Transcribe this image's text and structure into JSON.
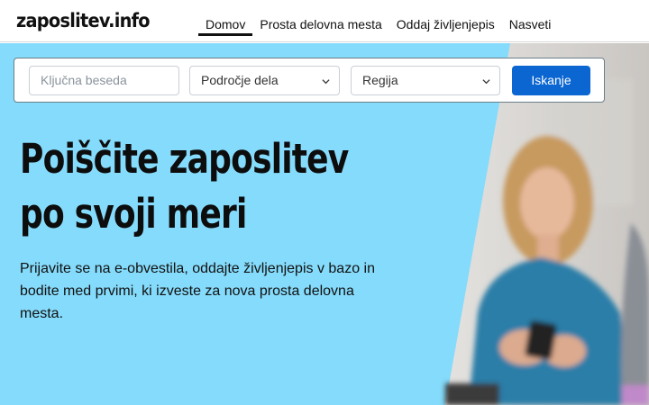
{
  "header": {
    "logo": "zaposlitev.info",
    "nav": [
      {
        "label": "Domov",
        "active": true
      },
      {
        "label": "Prosta delovna mesta",
        "active": false
      },
      {
        "label": "Oddaj življenjepis",
        "active": false
      },
      {
        "label": "Nasveti",
        "active": false
      }
    ]
  },
  "search": {
    "keyword_placeholder": "Ključna beseda",
    "area_selected": "Področje dela",
    "region_selected": "Regija",
    "button_label": "Iskanje"
  },
  "hero": {
    "headline_line1": "Poiščite zaposlitev",
    "headline_line2": "po svoji meri",
    "subtext": "Prijavite se na e-obvestila, oddajte življenjepis v bazo in bodite med prvimi, ki izveste za nova prosta delovna mesta."
  },
  "colors": {
    "hero_bg": "#85dbfb",
    "button": "#0b66d1",
    "text": "#111111"
  },
  "icons": [
    "chevron-down-icon"
  ]
}
